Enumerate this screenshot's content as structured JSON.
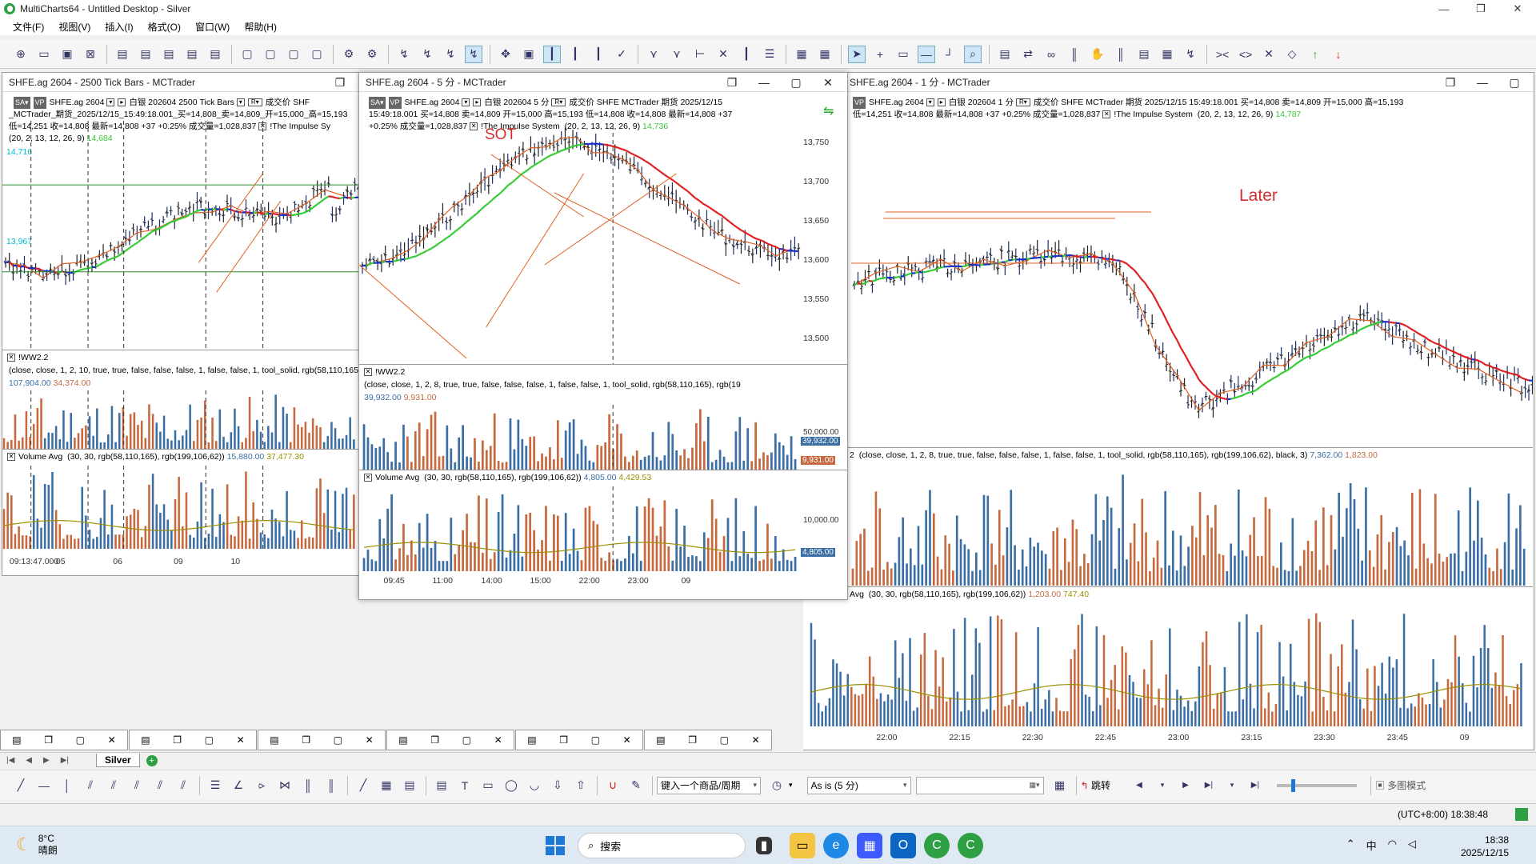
{
  "titlebar": {
    "title": "MultiCharts64 - Untitled Desktop - Silver",
    "min": "—",
    "max": "❐",
    "close": "✕"
  },
  "menu": [
    "文件(F)",
    "视图(V)",
    "插入(I)",
    "格式(O)",
    "窗口(W)",
    "帮助(H)"
  ],
  "colors": {
    "up": "#3a6ea5",
    "down": "#c7693e",
    "ma_red": "#e02020",
    "ma_green": "#33cc33",
    "ma_blue": "#1a2fcf",
    "trend": "#e06020"
  },
  "win_left": {
    "title": "SHFE.ag 2604 - 2500 Tick Bars - MCTrader",
    "line1": "白银 202604  2500 Tick Bars",
    "line1b": "成交价  SHF",
    "line2": "_MCTrader_期货_2025/12/15_15:49:18.001_买=14,808_卖=14,809_开=15,000_高=15,193",
    "line3": "低=14,251 收=14,808 最新=14,808 +37 +0.25% 成交量=1,028,837",
    "line3b": "!The Impulse Sy",
    "params": "(20, 2, 13, 12, 26, 9)",
    "param_val": "14,684",
    "level1": "14,716",
    "level2": "13,967",
    "ww_name": "!WW2.2",
    "ww_params": "(close, close, 1, 2, 10, true, true, false, false, false, 1, false, false, 1, tool_solid, rgb(58,110,165), rgb(",
    "ww_v1": "107,904.00",
    "ww_v2": "34,374.00",
    "va_name": "Volume Avg",
    "va_params": "(30, 30, rgb(58,110,165), rgb(199,106,62))",
    "va_v1": "15,880.00",
    "va_v2": "37,477.30",
    "xlabels": [
      "09:13:47.000",
      "05",
      "06",
      "09",
      "10"
    ]
  },
  "win_mid": {
    "title": "SHFE.ag 2604 - 5 分 - MCTrader",
    "line1": "白银 202604  5 分",
    "line1b": "成交价  SHFE  MCTrader  期货  2025/12/15",
    "line2": "15:49:18.001  买=14,808  卖=14,809  开=15,000  高=15,193  低=14,808  收=14,808  最新=14,808  +37",
    "line3": "+0.25%  成交量=1,028,837",
    "line3b": "!The Impulse System",
    "params": "(20, 2, 13, 12, 26, 9)",
    "param_val": "14,736",
    "annotation": "SOT",
    "yticks": [
      "13,750",
      "13,700",
      "13,650",
      "13,600",
      "13,550",
      "13,500"
    ],
    "ww_name": "!WW2.2",
    "ww_params": "(close, close, 1, 2, 8, true, true, false, false, false, 1, false, false, 1, tool_solid, rgb(58,110,165), rgb(19",
    "ww_v1": "39,932.00",
    "ww_v2": "9,931.00",
    "ww_tick": "50,000.00",
    "ww_tag1": "39,932.00",
    "ww_tag2": "9,931.00",
    "va_name": "Volume Avg",
    "va_params": "(30, 30, rgb(58,110,165), rgb(199,106,62))",
    "va_v1": "4,805.00",
    "va_v2": "4,429.53",
    "va_tick": "10,000.00",
    "va_tag": "4,805.00",
    "xlabels": [
      "09:45",
      "11:00",
      "14:00",
      "15:00",
      "22:00",
      "23:00",
      "09"
    ]
  },
  "win_right": {
    "title": "SHFE.ag 2604 - 1 分 - MCTrader",
    "line1": "白银 202604  1 分",
    "line1b": "成交价  SHFE  MCTrader  期货  2025/12/15  15:49:18.001  买=14,808  卖=14,809  开=15,000  高=15,193",
    "line2": "低=14,251 收=14,808 最新=14,808 +37 +0.25% 成交量=1,028,837",
    "line2b": "!The Impulse System",
    "params": "(20, 2, 13, 12, 26, 9)",
    "param_val": "14,787",
    "annotation": "Later",
    "ww_params": "(close, close, 1, 2, 8, true, true, false, false, false, 1, false, false, 1, tool_solid, rgb(58,110,165), rgb(199,106,62), black, 3)",
    "ww_v1": "7,362.00",
    "ww_v2": "1,823.00",
    "va_name": "Avg",
    "va_params": "(30, 30, rgb(58,110,165), rgb(199,106,62))",
    "va_v1": "1,203.00",
    "va_v2": "747.40",
    "xlabels": [
      "22:00",
      "22:15",
      "22:30",
      "22:45",
      "23:00",
      "23:15",
      "23:30",
      "23:45",
      "09"
    ]
  },
  "sheet": {
    "tab": "Silver"
  },
  "toolbar2": {
    "symbol_input": "键入一个商品/周期",
    "interval": "As is (5 分)",
    "jump": "跳转",
    "multi": "多图模式"
  },
  "status": {
    "clock": "(UTC+8:00) 18:38:48"
  },
  "taskbar": {
    "temp": "8°C",
    "cond": "晴朗",
    "search": "搜索",
    "ime": "中",
    "time": "18:38",
    "date": "2025/12/15"
  }
}
